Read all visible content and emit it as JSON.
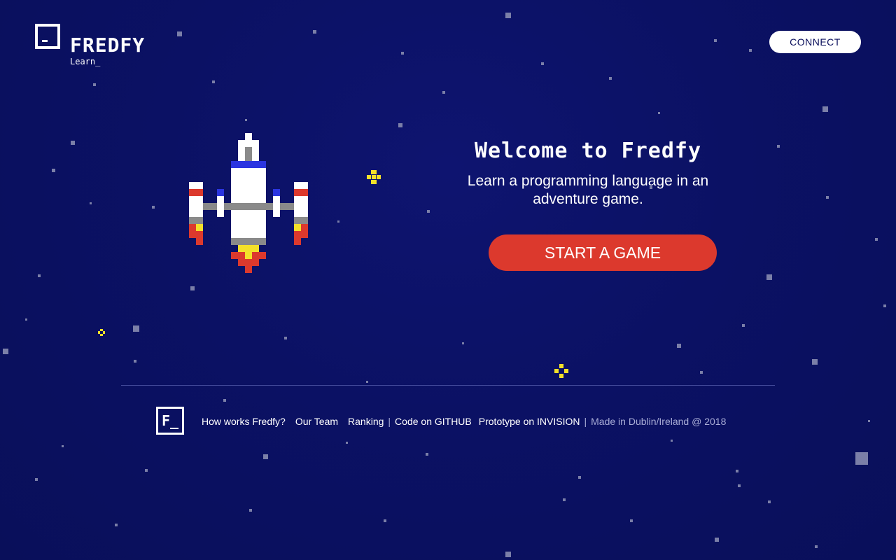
{
  "header": {
    "logo_word": "FREDFY",
    "logo_sub": "Learn_",
    "connect_label": "CONNECT"
  },
  "hero": {
    "title": "Welcome to Fredfy",
    "subtitle": "Learn a programming language in an adventure game.",
    "start_label": "START A GAME"
  },
  "footer": {
    "logo_mark": "F_",
    "links": {
      "how": "How works Fredfy?",
      "team": "Our Team",
      "ranking": "Ranking",
      "github": "Code on GITHUB",
      "invision": "Prototype on INVISION"
    },
    "separator": "|",
    "credit": "Made in Dublin/Ireland @ 2018"
  },
  "colors": {
    "background": "#0b1164",
    "start_button": "#dc392d",
    "sparkle": "#f4e02a"
  },
  "icons": {
    "ship": "pixel-spaceship-icon",
    "sparkle": "sparkle-icon"
  }
}
